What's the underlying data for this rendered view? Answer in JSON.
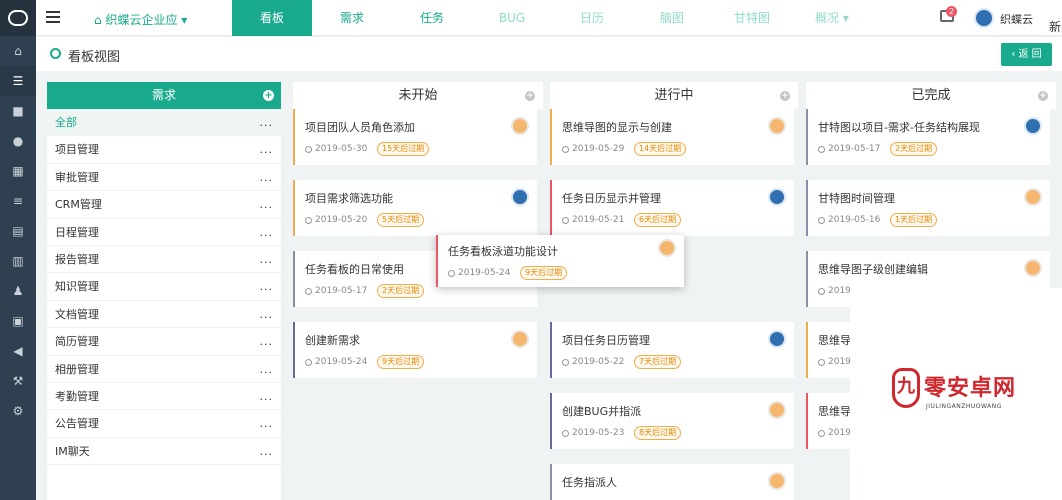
{
  "top": {
    "company": "织蝶云企业应",
    "company_caret": "▾",
    "tabs": [
      {
        "label": "看板"
      },
      {
        "label": "需求"
      },
      {
        "label": "任务"
      },
      {
        "label": "BUG"
      },
      {
        "label": "日历"
      },
      {
        "label": "脑图"
      },
      {
        "label": "甘特图"
      },
      {
        "label": "概况 ▾"
      }
    ],
    "badge": "2",
    "user_name": "织蝶云",
    "corner_text": "新"
  },
  "page": {
    "title": "看板视图",
    "back_label": "‹ 返 回"
  },
  "category_panel": {
    "header": "需求",
    "plus": "+",
    "dots": "...",
    "items": [
      "全部",
      "项目管理",
      "审批管理",
      "CRM管理",
      "日程管理",
      "报告管理",
      "知识管理",
      "文档管理",
      "简历管理",
      "相册管理",
      "考勤管理",
      "公告管理",
      "IM聊天"
    ]
  },
  "columns": [
    {
      "title": "未开始",
      "cards": [
        {
          "title": "项目团队人员角色添加",
          "date": "2019-05-30",
          "tag": "15天后过期",
          "avatar": "orange"
        },
        {
          "title": "项目需求筛选功能",
          "date": "2019-05-20",
          "tag": "5天后过期",
          "avatar": "blue"
        },
        {
          "title": "任务看板的日常使用",
          "date": "2019-05-17",
          "tag": "2天后过期",
          "avatar": "none"
        },
        {
          "title": "创建新需求",
          "date": "2019-05-24",
          "tag": "9天后过期",
          "avatar": "orange"
        }
      ]
    },
    {
      "title": "进行中",
      "cards": [
        {
          "title": "思维导图的显示与创建",
          "date": "2019-05-29",
          "tag": "14天后过期",
          "avatar": "orange"
        },
        {
          "title": "任务日历显示并管理",
          "date": "2019-05-21",
          "tag": "6天后过期",
          "avatar": "blue"
        },
        {
          "title": "项目任务日历管理",
          "date": "2019-05-22",
          "tag": "7天后过期",
          "avatar": "blue"
        },
        {
          "title": "创建BUG并指派",
          "date": "2019-05-23",
          "tag": "8天后过期",
          "avatar": "orange"
        },
        {
          "title": "任务指派人",
          "avatar": "orange"
        }
      ]
    },
    {
      "title": "已完成",
      "cards": [
        {
          "title": "甘特图以项目-需求-任务结构展现",
          "date": "2019-05-17",
          "tag": "2天后过期",
          "avatar": "blue"
        },
        {
          "title": "甘特图时间管理",
          "date": "2019-05-16",
          "tag": "1天后过期",
          "avatar": "orange"
        },
        {
          "title": "思维导图子级创建编辑",
          "date": "2019-",
          "avatar": "orange"
        },
        {
          "title": "思维导",
          "date": "2019-"
        },
        {
          "title": "思维导",
          "date": "2019-"
        }
      ]
    }
  ],
  "dragging_card": {
    "title": "任务看板泳道功能设计",
    "date": "2019-05-24",
    "tag": "9天后过期",
    "avatar": "orange"
  },
  "watermark": {
    "mark": "九",
    "text": "零安卓网",
    "sub": "JIULINGANZHUOWANG"
  },
  "colors": {
    "accent": "#19aa8d",
    "rail": "#2f4050",
    "warn": "#f0ad4e",
    "danger": "#ed5565"
  }
}
